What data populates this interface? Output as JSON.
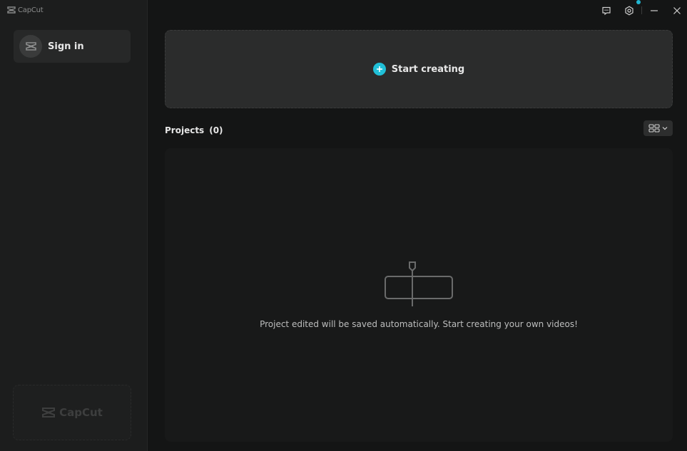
{
  "app": {
    "name": "CapCut"
  },
  "sidebar": {
    "signin_label": "Sign in",
    "promo_text": "CapCut"
  },
  "titlebar": {
    "buttons": [
      "feedback-icon",
      "settings-icon",
      "minimize-icon",
      "close-icon"
    ]
  },
  "main": {
    "start_label": "Start creating",
    "projects_label": "Projects",
    "projects_count": "(0)",
    "empty_message": "Project edited will be saved automatically. Start creating your own videos!"
  },
  "colors": {
    "accent": "#20c0d8",
    "notification_dot": "#21b6d1"
  }
}
